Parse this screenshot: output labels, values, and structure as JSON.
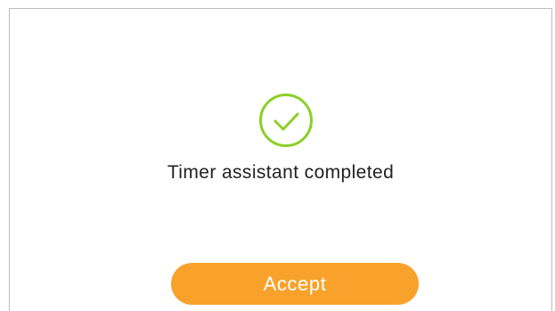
{
  "dialog": {
    "message": "Timer assistant completed",
    "status_icon": "check-circle-icon",
    "accept_label": "Accept"
  },
  "colors": {
    "accent": "#f8a22b",
    "success": "#8ccf2a",
    "text": "#222222",
    "border": "#bdbdbd"
  }
}
